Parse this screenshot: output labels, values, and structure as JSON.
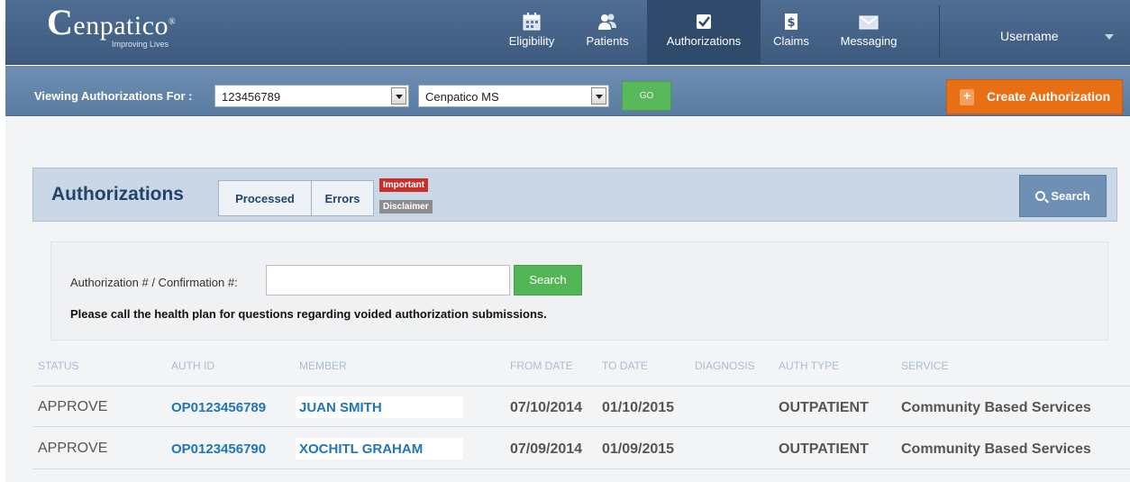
{
  "brand": {
    "logo_text": "enpatico",
    "logo_initial": "C",
    "tagline": "Improving Lives",
    "reg": "®"
  },
  "nav": {
    "items": [
      {
        "label": "Eligibility",
        "icon": "calendar-icon"
      },
      {
        "label": "Patients",
        "icon": "users-icon"
      },
      {
        "label": "Authorizations",
        "icon": "checkbox-icon"
      },
      {
        "label": "Claims",
        "icon": "dollar-document-icon"
      },
      {
        "label": "Messaging",
        "icon": "envelope-icon"
      }
    ],
    "active": "Authorizations",
    "user": "Username"
  },
  "viewing": {
    "label": "Viewing Authorizations For :",
    "provider_id": "123456789",
    "plan": "Cenpatico MS",
    "go_label": "GO",
    "create_label": "Create Authorization"
  },
  "auth": {
    "title": "Authorizations",
    "tabs": [
      "Processed",
      "Errors"
    ],
    "badge_important": "Important",
    "badge_disclaimer": "Disclaimer",
    "search_label": "Search"
  },
  "panel": {
    "label": "Authorization # / Confirmation #:",
    "input_value": "",
    "search_label": "Search",
    "note": "Please call the health plan for questions regarding voided authorization submissions."
  },
  "table": {
    "headers": [
      "STATUS",
      "AUTH ID",
      "MEMBER",
      "FROM DATE",
      "TO DATE",
      "DIAGNOSIS",
      "AUTH TYPE",
      "SERVICE"
    ],
    "rows": [
      {
        "status": "APPROVE",
        "auth_id": "OP0123456789",
        "member": "JUAN SMITH",
        "from": "07/10/2014",
        "to": "01/10/2015",
        "diagnosis": "",
        "auth_type": "OUTPATIENT",
        "service": "Community Based Services"
      },
      {
        "status": "APPROVE",
        "auth_id": "OP0123456790",
        "member": "XOCHITL GRAHAM",
        "from": "07/09/2014",
        "to": "01/09/2015",
        "diagnosis": "",
        "auth_type": "OUTPATIENT",
        "service": "Community Based Services"
      }
    ]
  },
  "colors": {
    "nav_bg": "#3d5a7e",
    "accent_orange": "#e86f14",
    "accent_green": "#53b656",
    "link_blue": "#2176b3"
  }
}
